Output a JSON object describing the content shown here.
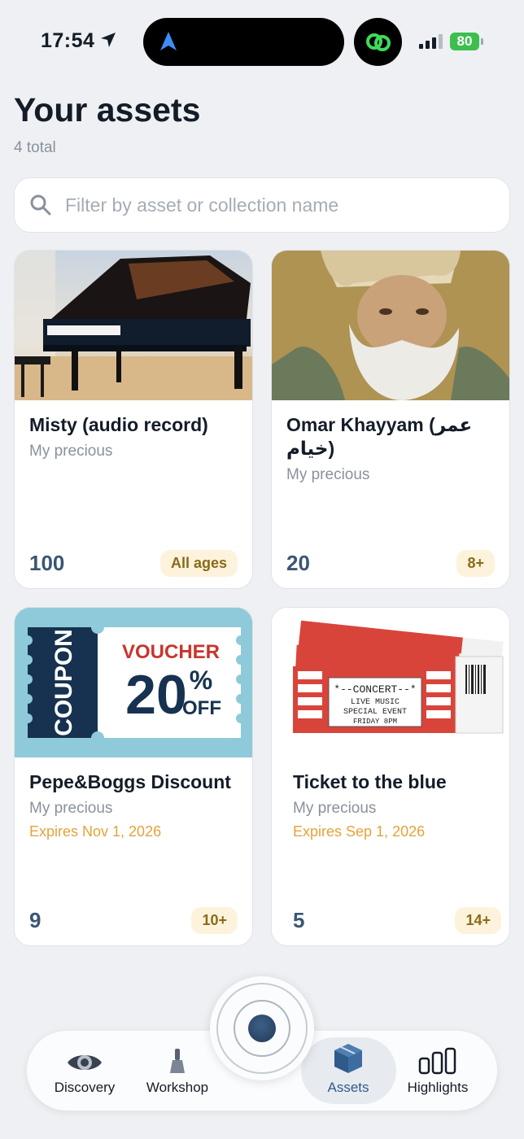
{
  "status": {
    "time": "17:54",
    "battery": "80"
  },
  "header": {
    "title": "Your assets",
    "total": "4 total"
  },
  "search": {
    "placeholder": "Filter by asset or collection name"
  },
  "cards": [
    {
      "title": "Misty (audio record)",
      "collection": "My precious",
      "expires": "",
      "count": "100",
      "badge": "All ages",
      "image": "grand-piano"
    },
    {
      "title": "Omar Khayyam (عمر خيام)",
      "collection": "My precious",
      "expires": "",
      "count": "20",
      "badge": "8+",
      "image": "portrait-painting"
    },
    {
      "title": "Pepe&Boggs Discount",
      "collection": "My precious",
      "expires": "Expires Nov 1, 2026",
      "count": "9",
      "badge": "10+",
      "image": "coupon",
      "coupon": {
        "side": "COUPON",
        "top": "VOUCHER",
        "pct": "20",
        "pct_sign": "%",
        "off": "OFF"
      }
    },
    {
      "title": "Ticket to the blue",
      "collection": "My precious",
      "expires": "Expires Sep 1, 2026",
      "count": "5",
      "badge": "14+",
      "image": "concert-tickets",
      "ticket": {
        "line1": "*--CONCERT--*",
        "line2": "LIVE MUSIC",
        "line3": "SPECIAL EVENT",
        "line4": "FRIDAY 8PM"
      }
    }
  ],
  "nav": {
    "items": [
      {
        "label": "Discovery",
        "icon": "eye-icon"
      },
      {
        "label": "Workshop",
        "icon": "pawn-icon"
      },
      {
        "label": "Assets",
        "icon": "cube-icon",
        "active": true
      },
      {
        "label": "Highlights",
        "icon": "bars-icon"
      }
    ]
  },
  "colors": {
    "accent": "#3a5673",
    "expiry": "#e6a23c",
    "badge_bg": "#fdf3dc"
  }
}
